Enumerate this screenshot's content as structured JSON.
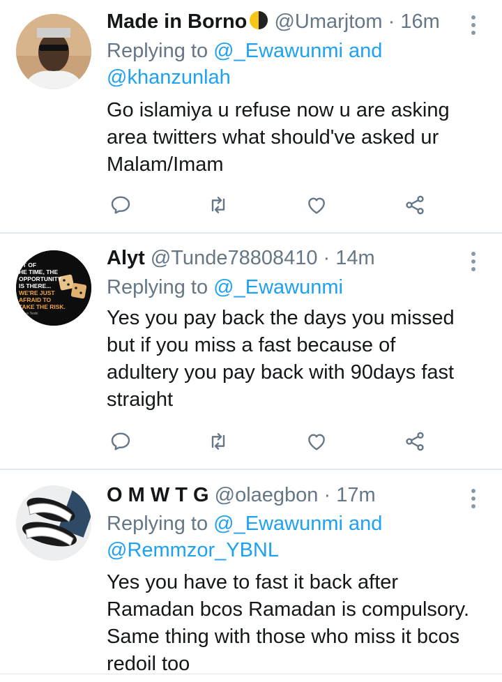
{
  "tweets": [
    {
      "name": "Made in Borno",
      "badge_icon": "half-moon-emoji",
      "handle": "@Umarjtom",
      "sep": "·",
      "time": "16m",
      "replying_prefix": "Replying to",
      "mentions": [
        "@_Ewawunmi",
        "and",
        "@khanzunlah"
      ],
      "text_lines": [
        "Go islamiya u refuse now u are asking",
        "area twitters what should've asked ur",
        "Malam/Imam"
      ]
    },
    {
      "name": "Alyt",
      "handle": "@Tunde78808410",
      "sep": "·",
      "time": "14m",
      "replying_prefix": "Replying to",
      "mentions": [
        "@_Ewawunmi"
      ],
      "avatar_text": [
        "ST OF",
        "HE TIME, THE",
        "OPPORTUNITY",
        "IS THERE...",
        "WE'RE JUST",
        "AFRAID TO",
        "TAKE THE RISK.",
        "Sonye Teobi"
      ],
      "text_lines": [
        "Yes you pay back the days you missed",
        "but if you miss a fast because of",
        "adultery you pay back with 90days fast",
        "straight"
      ]
    },
    {
      "name": "O M W T G",
      "handle": "@olaegbon",
      "sep": "·",
      "time": "17m",
      "replying_prefix": "Replying to",
      "mentions": [
        "@_Ewawunmi",
        "and",
        "@Remmzor_YBNL"
      ],
      "text_lines": [
        "Yes you have to fast it back after",
        "Ramadan bcos Ramadan is compulsory.",
        "Same thing with those who miss it bcos",
        "redoil too"
      ]
    }
  ],
  "actions": [
    "reply-icon",
    "retweet-icon",
    "like-icon",
    "share-icon"
  ],
  "colors": {
    "link": "#1da1f2",
    "secondary": "#657786",
    "text": "#14171a",
    "divider": "#e1e8ed"
  }
}
